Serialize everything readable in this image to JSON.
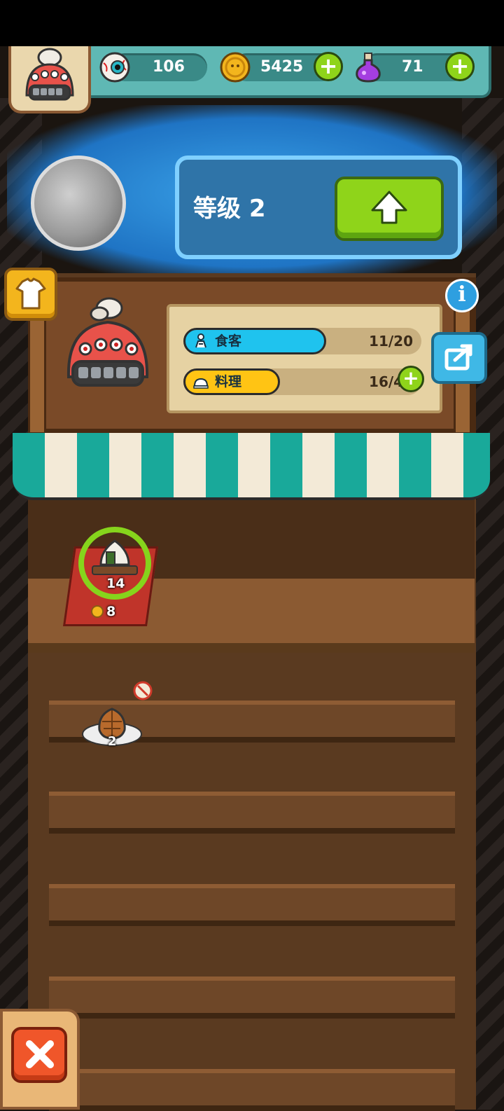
{
  "resources": {
    "eyeballs": "106",
    "coins": "5425",
    "potions": "71",
    "add_symbol": "+"
  },
  "level": {
    "label": "等级 2"
  },
  "stats": {
    "guests": {
      "label": "食客",
      "value": "11/20",
      "fill": 0.55
    },
    "dishes": {
      "label": "料理",
      "value": "16/48",
      "fill": 0.333
    }
  },
  "info_symbol": "i",
  "shelf_items": [
    {
      "quantity": "14",
      "price": "8"
    },
    {
      "quantity": "2"
    }
  ],
  "colors": {
    "accent_green": "#8fd41a",
    "guests_bar": "#1fc3ee",
    "dishes_bar": "#ffc414",
    "panel_teal": "#5fb8b4"
  },
  "icons": [
    "eyeball-icon",
    "coin-icon",
    "potion-icon",
    "shirt-icon",
    "info-icon",
    "share-icon",
    "up-arrow-icon",
    "close-icon",
    "no-entry-icon"
  ]
}
